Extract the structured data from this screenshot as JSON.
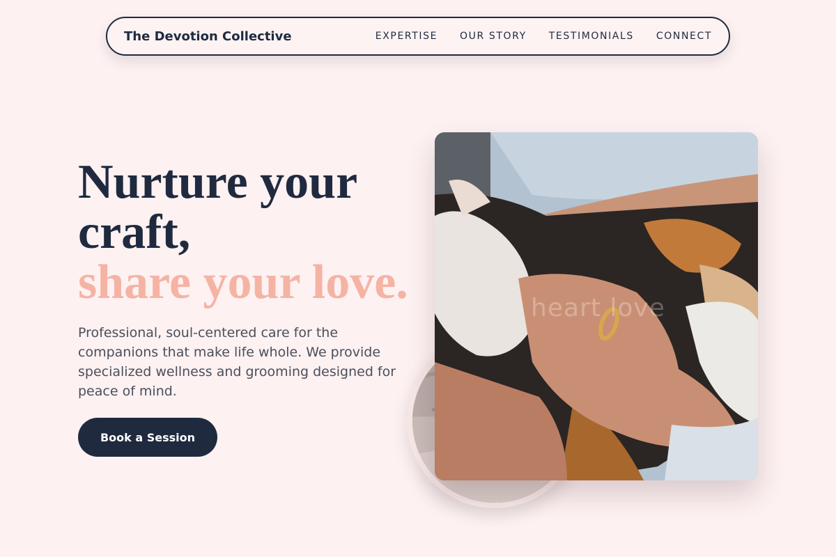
{
  "nav": {
    "brand": "The Devotion Collective",
    "links": [
      "EXPERTISE",
      "OUR STORY",
      "TESTIMONIALS",
      "CONNECT"
    ]
  },
  "hero": {
    "headline_line1": "Nurture your",
    "headline_line2": "craft,",
    "headline_accent": "share your love.",
    "lead": "Professional, soul-centered care for the companions that make life whole. We provide specialized wellness and grooming designed for peace of mind.",
    "cta_label": "Book a Session"
  },
  "image": {
    "watermark": "heart love",
    "description_icon": "cat-photo"
  },
  "colors": {
    "background": "#fdf1f1",
    "navy": "#1f2a3f",
    "accent": "#f5b3a4"
  }
}
